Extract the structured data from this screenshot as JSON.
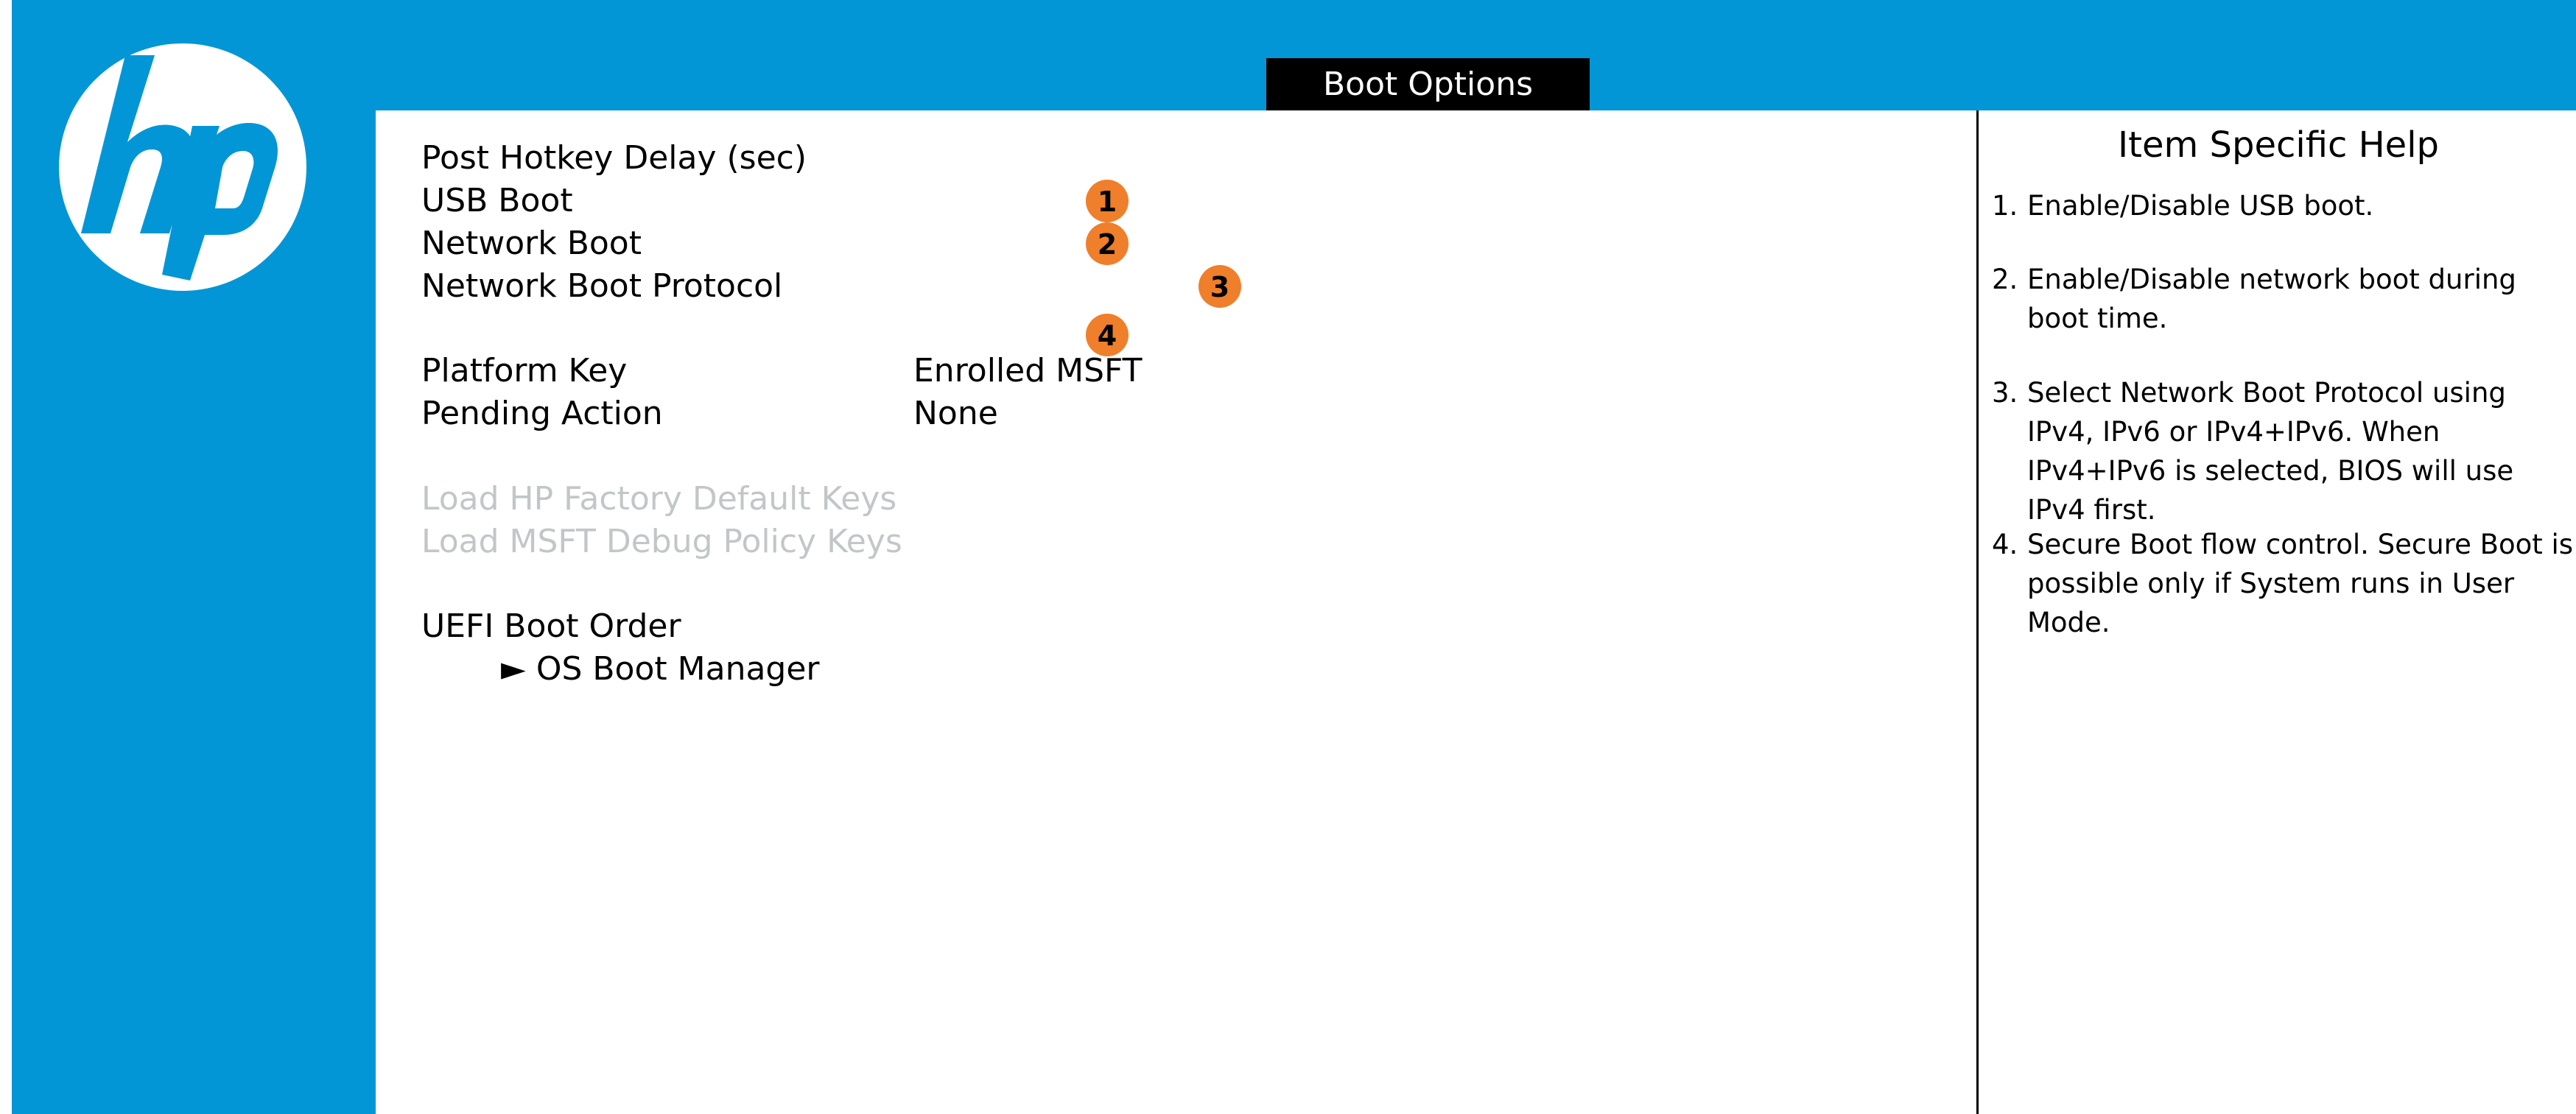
{
  "header": {
    "page_tab": "Boot Options",
    "logo_text": "hp"
  },
  "settings": {
    "post_hotkey_delay": "Post Hotkey Delay (sec)",
    "usb_boot": "USB Boot",
    "network_boot": "Network Boot",
    "network_boot_protocol": "Network Boot Protocol",
    "platform_key": {
      "label": "Platform Key",
      "value": "Enrolled MSFT"
    },
    "pending_action": {
      "label": "Pending Action",
      "value": "None"
    },
    "load_hp_factory_keys": "Load HP Factory Default Keys",
    "load_msft_debug_keys": "Load MSFT Debug Policy Keys",
    "uefi_boot_order": "UEFI Boot Order",
    "os_boot_manager": "► OS Boot Manager"
  },
  "badges": [
    "1",
    "2",
    "3",
    "4"
  ],
  "help": {
    "title": "Item Specific Help",
    "items": [
      {
        "num": "1.",
        "text": "Enable/Disable USB boot."
      },
      {
        "num": "2.",
        "text": "Enable/Disable network boot during boot time."
      },
      {
        "num": "3.",
        "text": "Select Network Boot Protocol using IPv4, IPv6 or IPv4+IPv6. When IPv4+IPv6 is selected, BIOS will use IPv4 first."
      },
      {
        "num": "4.",
        "text": "Secure Boot flow control. Secure Boot is possible only if System runs in User Mode."
      }
    ]
  },
  "colors": {
    "brand_blue": "#0296d6",
    "badge_orange": "#ef7f2a",
    "disabled_text": "#c3c6c9"
  }
}
